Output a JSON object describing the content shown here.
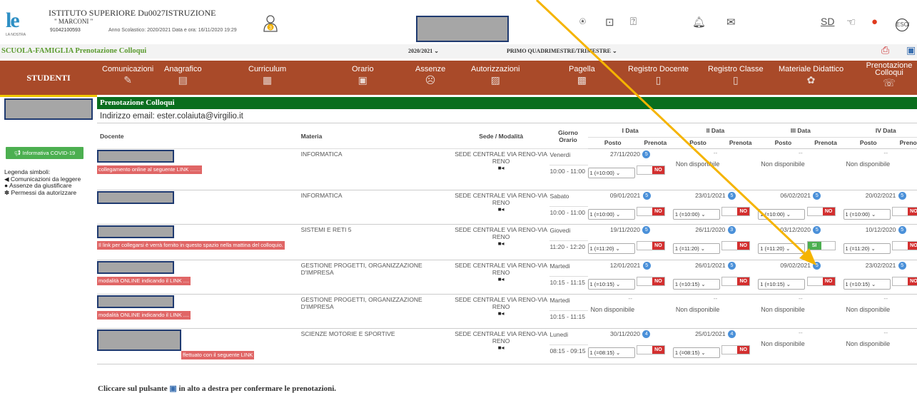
{
  "header": {
    "logo": "le",
    "logo_sub": "LA NOSTRA",
    "school_name": "ISTITUTO SUPERIORE Du0027ISTRUZIONE",
    "school_sub": "\" MARCONI \"",
    "code": "91042100593",
    "year_info": "Anno Scolastico: 2020/2021   Data e ora: 16/11/2020 19:29",
    "avatar_badge": "3",
    "icons": [
      "help-circle-icon",
      "lock-icon",
      "question-icon",
      "bell-icon",
      "mail-icon",
      "sd-icon",
      "hand-icon",
      "app-icon",
      "esc-icon"
    ],
    "sd_label": "SD",
    "esc_label": "ESCI"
  },
  "bar2": {
    "title": "SCUOLA-FAMIGLIA Prenotazione Colloqui",
    "year": "2020/2021 ⌄",
    "period": "PRIMO QUADRIMESTRE/TRIMESTRE   ⌄"
  },
  "nav": {
    "studenti": "STUDENTI",
    "items": [
      {
        "label": "Comunicazioni",
        "icon": "✎"
      },
      {
        "label": "Anagrafico",
        "icon": "▤"
      },
      {
        "label": "Curriculum",
        "icon": "▦"
      },
      {
        "label": "Orario",
        "icon": "▣"
      },
      {
        "label": "Assenze",
        "icon": "☹"
      },
      {
        "label": "Autorizzazioni",
        "icon": "▨"
      },
      {
        "label": "Pagella",
        "icon": "▩"
      },
      {
        "label": "Registro Docente",
        "icon": "▯"
      },
      {
        "label": "Registro Classe",
        "icon": "▯"
      },
      {
        "label": "Materiale Didattico",
        "icon": "✿"
      },
      {
        "label": "Prenotazione Colloqui",
        "icon": "☏"
      }
    ]
  },
  "left": {
    "covid_button": "Informativa COVID-19",
    "legend_title": "Legenda simboli:",
    "legend": [
      "Comunicazioni da leggere",
      "Assenze da giustificare",
      "Permessi da autorizzare"
    ]
  },
  "page": {
    "title": "Prenotazione Colloqui",
    "email": "Indirizzo email: ester.colaiuta@virgilio.it"
  },
  "table": {
    "headers": {
      "docente": "Docente",
      "materia": "Materia",
      "sede": "Sede / Modalità",
      "giorno": "Giorno Orario",
      "dates": [
        "I Data",
        "II Data",
        "III Data",
        "IV Data"
      ],
      "posto": "Posto",
      "prenota": "Prenota"
    },
    "rows": [
      {
        "link": "collegamento online al seguente LINK .......",
        "materia": "INFORMATICA",
        "sede": "SEDE CENTRALE VIA RENO-VIA RENO",
        "giorno": "Venerdi",
        "ora": "10:00 - 11:00",
        "slots": [
          {
            "date": "27/11/2020",
            "badge": "5",
            "posto": "1 (=10:00)",
            "toggle": "NO"
          },
          {
            "dash": "--",
            "nd": "Non disponibile"
          },
          {
            "dash": "--",
            "nd": "Non disponibile"
          },
          {
            "dash": "--",
            "nd": "Non disponibile"
          }
        ]
      },
      {
        "link": "",
        "materia": "INFORMATICA",
        "sede": "SEDE CENTRALE VIA RENO-VIA RENO",
        "giorno": "Sabato",
        "ora": "10:00 - 11:00",
        "slots": [
          {
            "date": "09/01/2021",
            "badge": "5",
            "posto": "1 (=10:00)",
            "toggle": "NO"
          },
          {
            "date": "23/01/2021",
            "badge": "5",
            "posto": "1 (=10:00)",
            "toggle": "NO"
          },
          {
            "date": "06/02/2021",
            "badge": "5",
            "posto": "1 (=10:00)",
            "toggle": "NO"
          },
          {
            "date": "20/02/2021",
            "badge": "5",
            "posto": "1 (=10:00)",
            "toggle": "NO"
          }
        ]
      },
      {
        "link": "Il link per collegarsi è verrà fornito in questo spazio nella mattina del colloquio.",
        "materia": "SISTEMI E RETI 5",
        "sede": "SEDE CENTRALE VIA RENO-VIA RENO",
        "giorno": "Giovedi",
        "ora": "11:20 - 12:20",
        "slots": [
          {
            "date": "19/11/2020",
            "badge": "5",
            "posto": "1 (=11:20)",
            "toggle": "NO"
          },
          {
            "date": "26/11/2020",
            "badge": "3",
            "posto": "1 (=11:20)",
            "toggle": "NO"
          },
          {
            "date": "03/12/2020",
            "badge": "5",
            "posto": "1 (=11:20)",
            "toggle": "SI"
          },
          {
            "date": "10/12/2020",
            "badge": "5",
            "posto": "1 (=11:20)",
            "toggle": "NO"
          }
        ]
      },
      {
        "link": "modalità ONLINE indicando il LINK ....",
        "materia": "GESTIONE PROGETTI, ORGANIZZAZIONE D'IMPRESA",
        "sede": "SEDE CENTRALE VIA RENO-VIA RENO",
        "giorno": "Martedi",
        "ora": "10:15 - 11:15",
        "slots": [
          {
            "date": "12/01/2021",
            "badge": "5",
            "posto": "1 (=10:15)",
            "toggle": "NO"
          },
          {
            "date": "26/01/2021",
            "badge": "5",
            "posto": "1 (=10:15)",
            "toggle": "NO"
          },
          {
            "date": "09/02/2021",
            "badge": "5",
            "posto": "1 (=10:15)",
            "toggle": "NO"
          },
          {
            "date": "23/02/2021",
            "badge": "5",
            "posto": "1 (=10:15)",
            "toggle": "NO"
          }
        ]
      },
      {
        "link": "modalità ONLINE indicando il LINK ....",
        "materia": "GESTIONE PROGETTI, ORGANIZZAZIONE D'IMPRESA",
        "sede": "SEDE CENTRALE VIA RENO-VIA RENO",
        "giorno": "Martedi",
        "ora": "10:15 - 11:15",
        "slots": [
          {
            "dash": "--",
            "nd": "Non disponibile"
          },
          {
            "dash": "--",
            "nd": "Non disponibile"
          },
          {
            "dash": "--",
            "nd": "Non disponibile"
          },
          {
            "dash": "--",
            "nd": "Non disponibile"
          }
        ]
      },
      {
        "link": "ffettuato con il seguente LINK",
        "materia": "SCIENZE MOTORIE E SPORTIVE",
        "sede": "SEDE CENTRALE VIA RENO-VIA RENO",
        "giorno": "Lunedi",
        "ora": "08:15 - 09:15",
        "slots": [
          {
            "date": "30/11/2020",
            "badge": "4",
            "posto": "1 (=08:15)",
            "toggle": "NO"
          },
          {
            "date": "25/01/2021",
            "badge": "4",
            "posto": "1 (=08:15)",
            "toggle": "NO"
          },
          {
            "dash": "--",
            "nd": "Non disponibile"
          },
          {
            "dash": "--",
            "nd": "Non disponibile"
          }
        ]
      }
    ]
  },
  "footer": {
    "before": "Cliccare sul pulsante",
    "after": "in alto a destra per confermare le prenotazioni."
  },
  "colors": {
    "nav": "#a94a29",
    "title_bar": "#0a6e1e",
    "annotation_arrow": "#f5b400"
  }
}
